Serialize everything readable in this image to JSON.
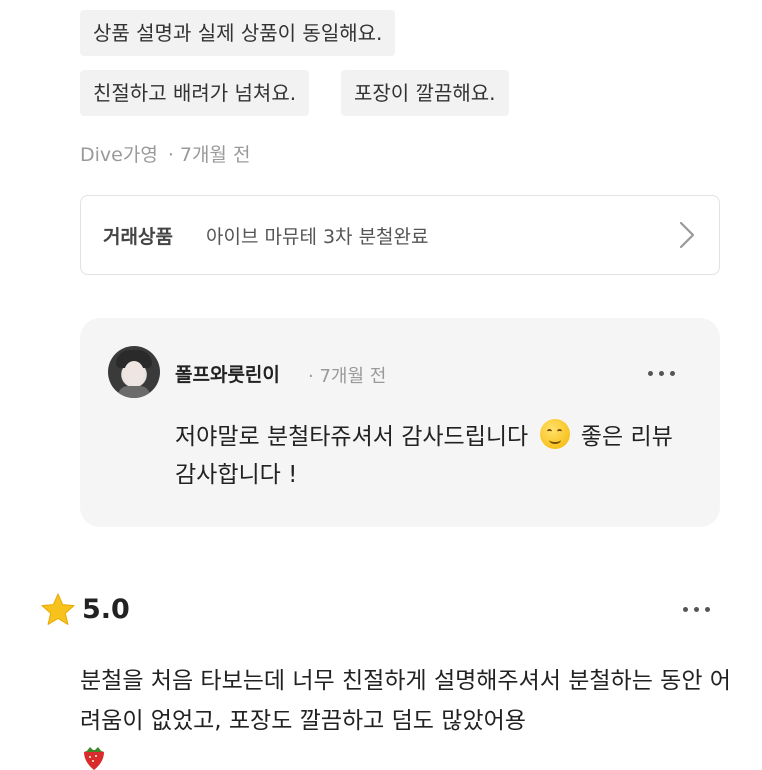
{
  "tags": [
    "상품 설명과 실제 상품이 동일해요.",
    "친절하고 배려가 넘쳐요.",
    "포장이 깔끔해요."
  ],
  "review_meta": {
    "author": "Dive가영",
    "separator": "·",
    "time": "7개월 전"
  },
  "product": {
    "label": "거래상품",
    "name": "아이브 마뮤테 3차 분철완료"
  },
  "reply": {
    "author": "폴프와룻린이",
    "time": "· 7개월 전",
    "text_before_emoji": "저야말로 분철타쥬셔서 감사드립니다 ",
    "text_after_emoji": " 좋은 리뷰 감사합니다 !",
    "emoji": "smiling-face-emoji"
  },
  "review2": {
    "rating": "5.0",
    "text": "분철을 처음 타보는데 너무 친절하게 설명해주셔서 분철하는 동안 어려움이 없었고, 포장도 깔끔하고 덤도 많았어용",
    "emoji": "strawberry-emoji"
  },
  "colors": {
    "star": "#f8c21c",
    "tag_bg": "#f2f2f2",
    "reply_bg": "#f5f5f5",
    "muted": "#9a9a9a"
  }
}
